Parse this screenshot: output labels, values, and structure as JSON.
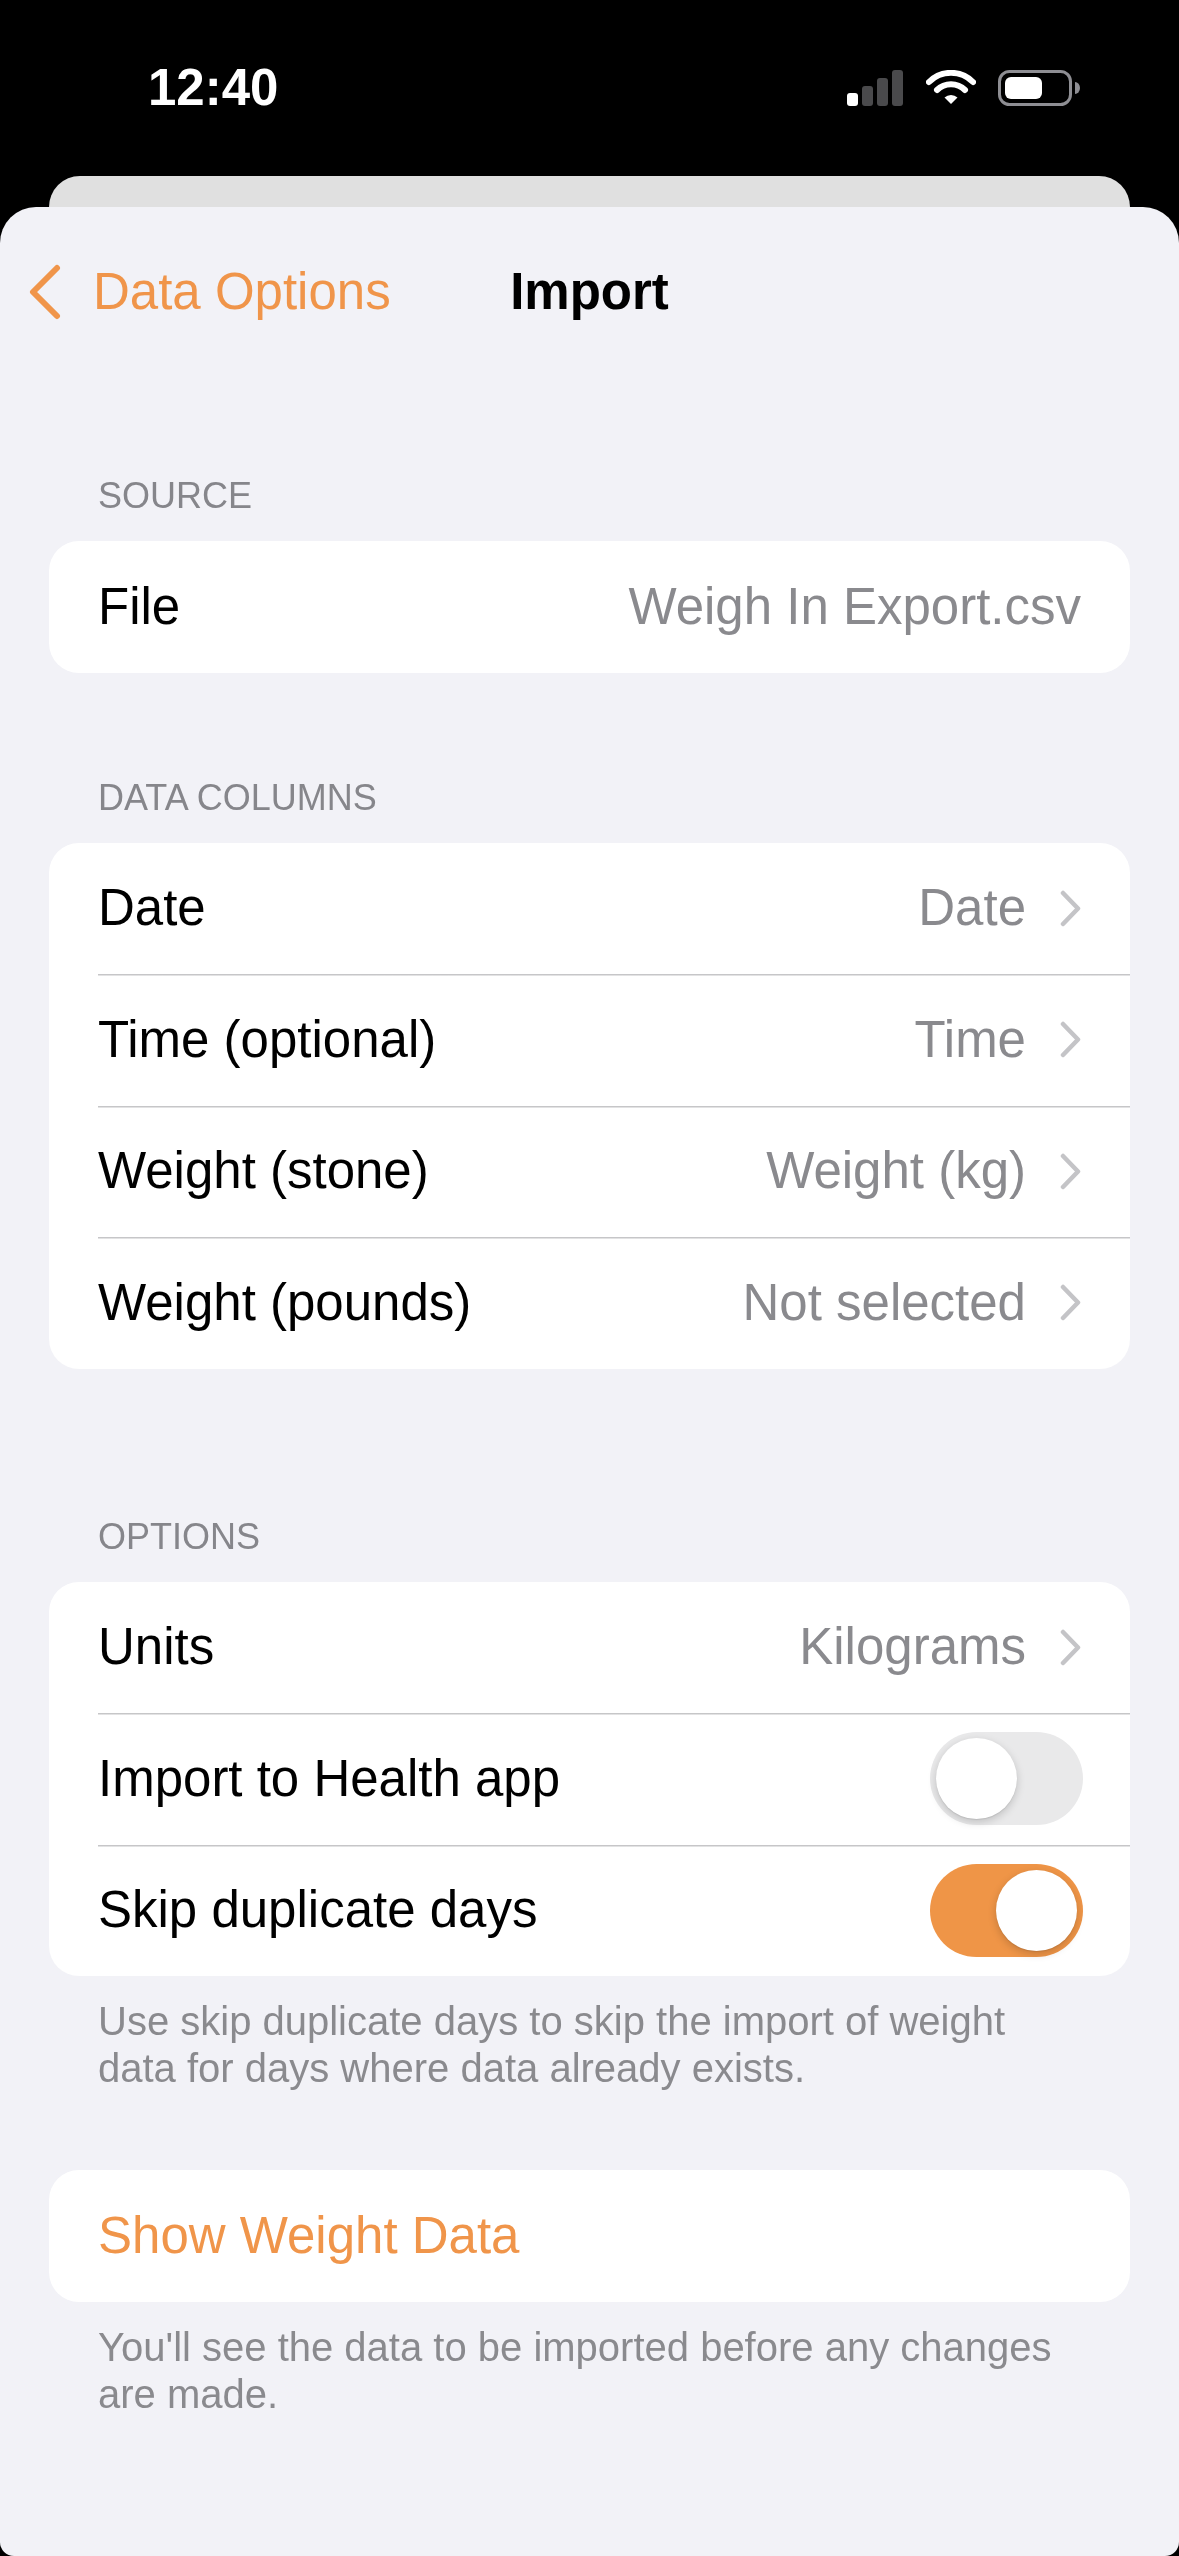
{
  "status_bar": {
    "time": "12:40"
  },
  "nav": {
    "back": "Data Options",
    "title": "Import"
  },
  "sections": [
    {
      "header": "SOURCE",
      "rows": [
        {
          "kind": "value",
          "label": "File",
          "value": "Weigh In Export.csv"
        }
      ]
    },
    {
      "header": "DATA COLUMNS",
      "rows": [
        {
          "kind": "link",
          "label": "Date",
          "value": "Date"
        },
        {
          "kind": "link",
          "label": "Time (optional)",
          "value": "Time"
        },
        {
          "kind": "link",
          "label": "Weight (stone)",
          "value": "Weight (kg)"
        },
        {
          "kind": "link",
          "label": "Weight (pounds)",
          "value": "Not selected"
        }
      ]
    },
    {
      "header": "OPTIONS",
      "rows": [
        {
          "kind": "link",
          "label": "Units",
          "value": "Kilograms"
        },
        {
          "kind": "toggle",
          "label": "Import to Health app",
          "on": false
        },
        {
          "kind": "toggle",
          "label": "Skip duplicate days",
          "on": true
        }
      ],
      "footer": "Use skip duplicate days to skip the import of weight data for days where data already exists."
    },
    {
      "rows": [
        {
          "kind": "action",
          "label": "Show Weight Data"
        }
      ],
      "footer": "You'll see the data to be imported before any changes are made."
    }
  ]
}
